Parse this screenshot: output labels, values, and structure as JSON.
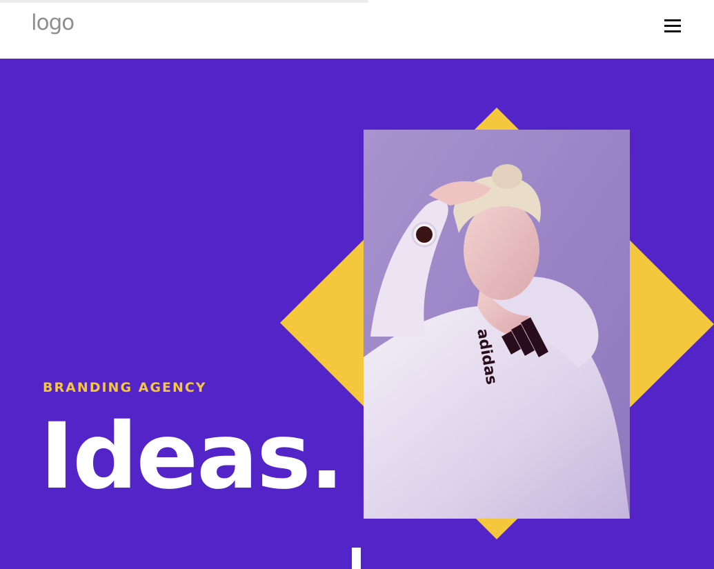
{
  "header": {
    "logo_text": "logo",
    "progress_fraction": 0.516,
    "menu_icon": "hamburger-menu-icon"
  },
  "hero": {
    "eyebrow": "BRANDING AGENCY",
    "headline": "Ideas.",
    "photo_brand_text": "adidas"
  },
  "colors": {
    "background": "#5325c8",
    "accent": "#f5c73d",
    "header_bg": "#ffffff",
    "headline": "#ffffff",
    "logo": "#8e8e8e"
  }
}
